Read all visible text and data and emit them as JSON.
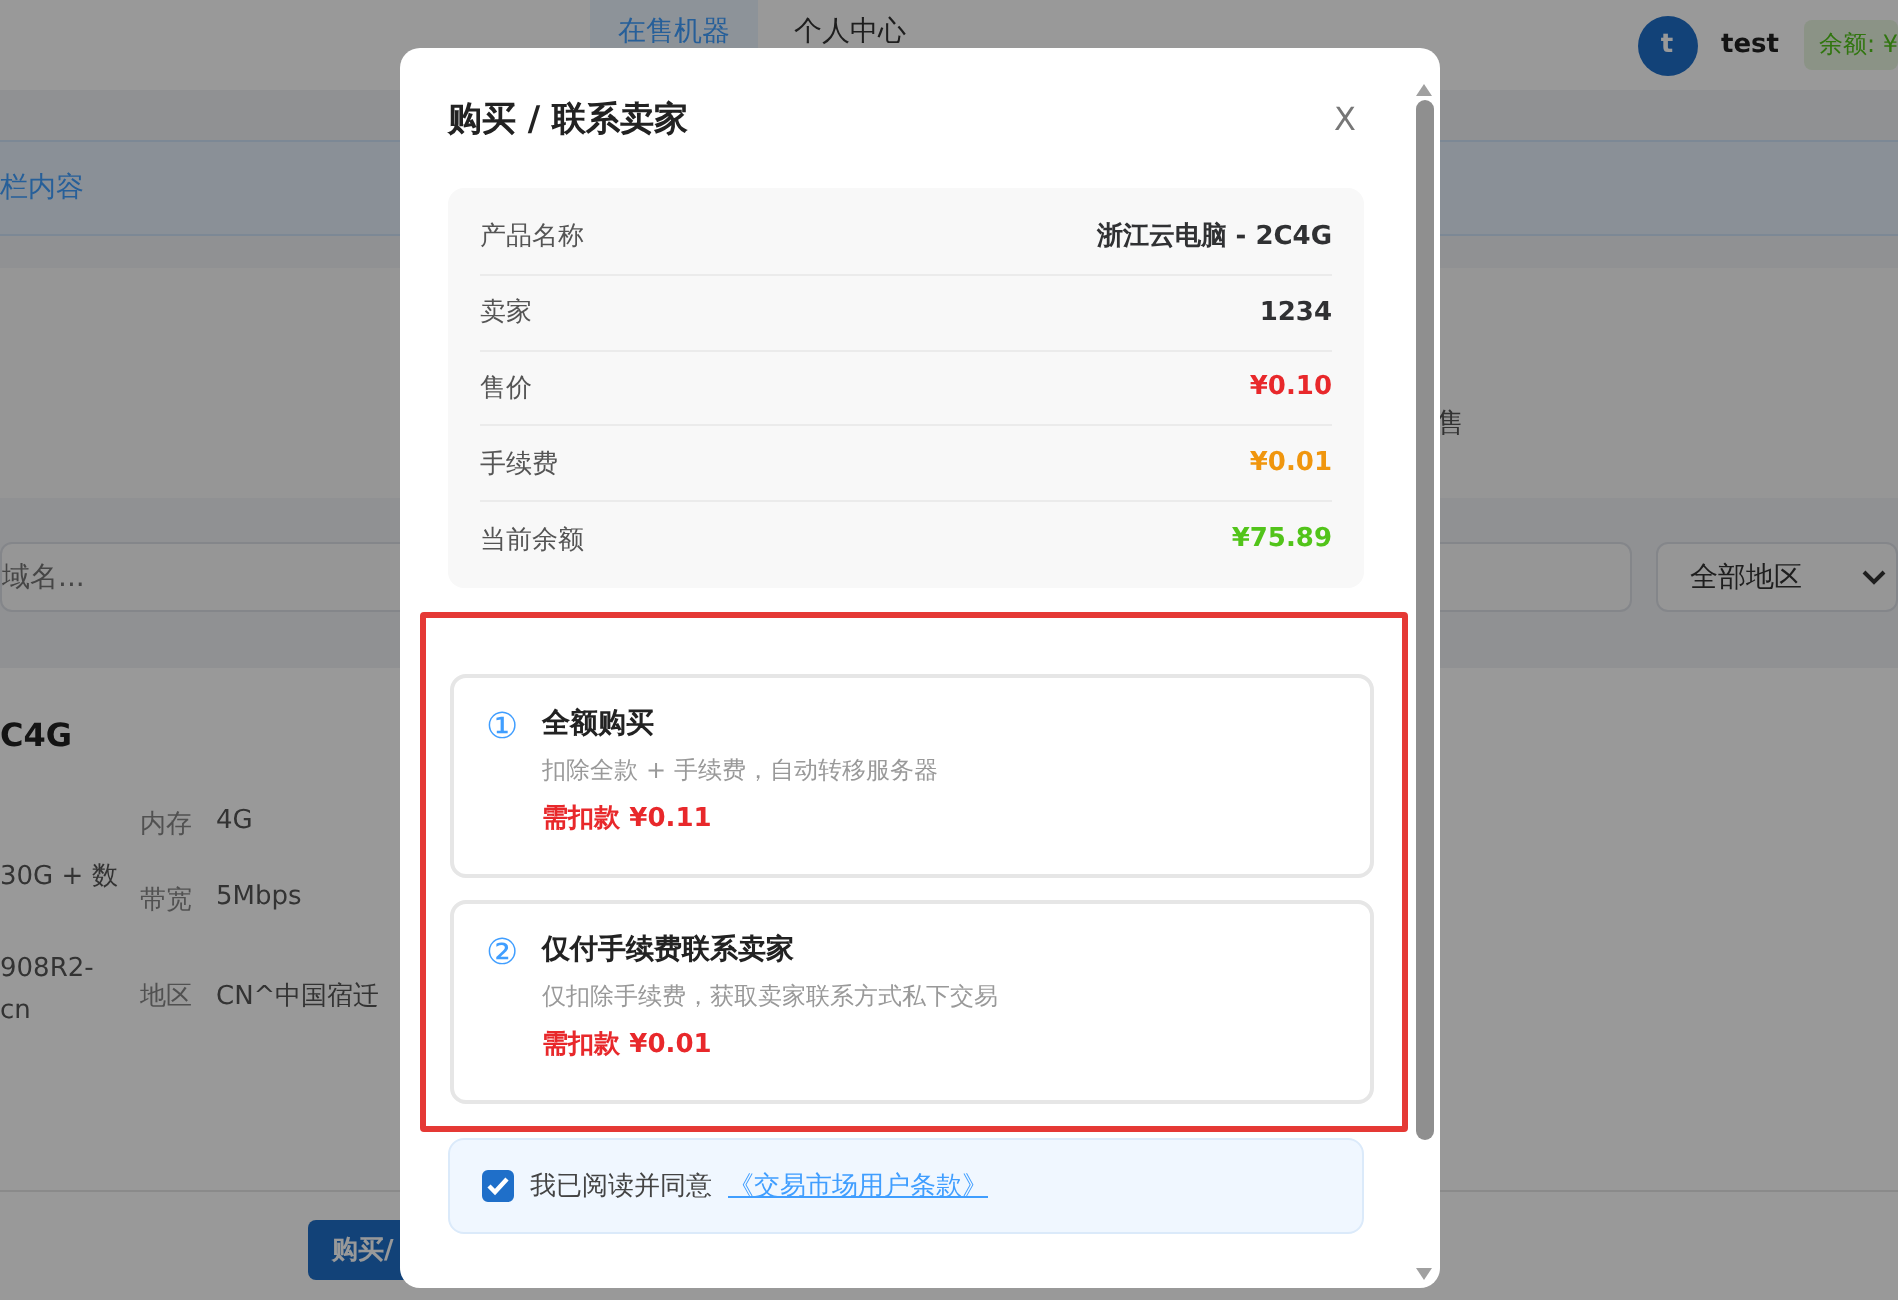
{
  "header": {
    "tabs": [
      {
        "label": "在售机器",
        "selected": true
      },
      {
        "label": "个人中心",
        "selected": false
      }
    ],
    "user": {
      "avatar": "t",
      "name": "test"
    },
    "balance_badge": "余额: ¥"
  },
  "notice": "栏内容",
  "stats": {
    "label": "售"
  },
  "filters": {
    "search": {
      "placeholder": "域名..."
    },
    "region": "全部地区"
  },
  "server_card": {
    "title": "C4G",
    "column_1": [
      "30G + 数",
      "908R2-",
      "cn"
    ],
    "specs": [
      {
        "label": "内存",
        "value": "4G"
      },
      {
        "label": "带宽",
        "value": "5Mbps"
      },
      {
        "label": "地区",
        "value": "CN^中国宿迁"
      }
    ],
    "button": "购买/"
  },
  "modal": {
    "title": "购买 / 联系卖家",
    "close": "X",
    "details": [
      {
        "label": "产品名称",
        "value": "浙江云电脑 - 2C4G",
        "kind": "plain"
      },
      {
        "label": "卖家",
        "value": "1234",
        "kind": "plain"
      },
      {
        "label": "售价",
        "value": "¥0.10",
        "kind": "price"
      },
      {
        "label": "手续费",
        "value": "¥0.01",
        "kind": "fee"
      },
      {
        "label": "当前余额",
        "value": "¥75.89",
        "kind": "balance"
      }
    ],
    "options": [
      {
        "number": "①",
        "title": "全额购买",
        "description": "扣除全款 + 手续费，自动转移服务器",
        "charge_label": "需扣款",
        "charge": "¥0.11"
      },
      {
        "number": "②",
        "title": "仅付手续费联系卖家",
        "description": "仅扣除手续费，获取卖家联系方式私下交易",
        "charge_label": "需扣款",
        "charge": "¥0.01"
      }
    ],
    "agreement": {
      "checked": true,
      "text": "我已阅读并同意",
      "link": "《交易市场用户条款》"
    }
  }
}
